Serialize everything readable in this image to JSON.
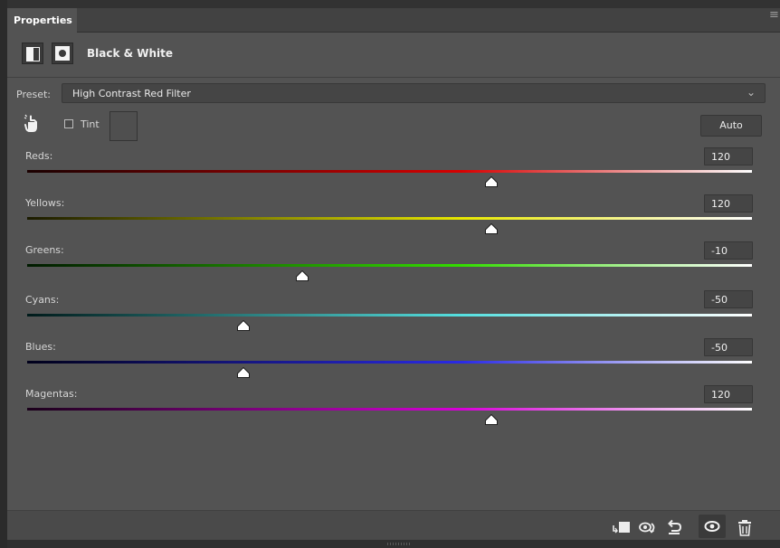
{
  "panel": {
    "tab_label": "Properties",
    "title": "Black & White"
  },
  "icons": {
    "menu": "panel-menu-icon",
    "adjustment": "adjustment-layer-icon",
    "mask": "layer-mask-icon",
    "hand": "targeted-adjustment-hand-icon",
    "clip": "clip-to-layer-icon",
    "view_previous": "view-previous-state-icon",
    "reset": "reset-icon",
    "visibility": "eye-icon",
    "delete": "trash-icon"
  },
  "preset": {
    "label": "Preset:",
    "value": "High Contrast Red Filter"
  },
  "tint": {
    "label": "Tint",
    "checked": false
  },
  "auto_label": "Auto",
  "sliders": [
    {
      "label": "Reds:",
      "value": "120",
      "start_color": "#1a0000",
      "mid_color": "#d80000",
      "end_color": "#ffffff"
    },
    {
      "label": "Yellows:",
      "value": "120",
      "start_color": "#1a1a00",
      "mid_color": "#e8e800",
      "end_color": "#ffffff"
    },
    {
      "label": "Greens:",
      "value": "-10",
      "start_color": "#001a00",
      "mid_color": "#33dd00",
      "end_color": "#ffffff"
    },
    {
      "label": "Cyans:",
      "value": "-50",
      "start_color": "#001a1a",
      "mid_color": "#55e0e0",
      "end_color": "#ffffff"
    },
    {
      "label": "Blues:",
      "value": "-50",
      "start_color": "#00001a",
      "mid_color": "#2a2ae6",
      "end_color": "#ffffff"
    },
    {
      "label": "Magentas:",
      "value": "120",
      "start_color": "#1a001a",
      "mid_color": "#d800d8",
      "end_color": "#ffffff"
    }
  ]
}
